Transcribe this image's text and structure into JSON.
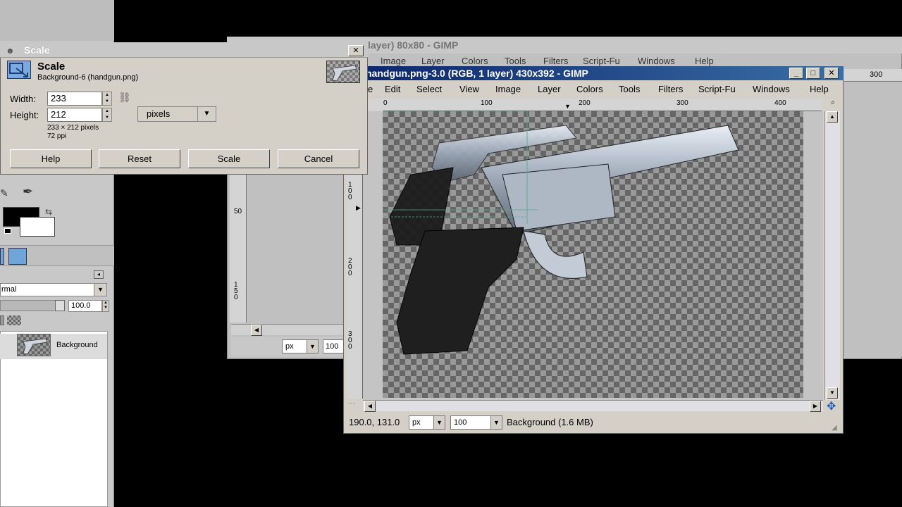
{
  "scale_dialog": {
    "title": "Scale",
    "heading": "Scale",
    "subheading": "Background-6 (handgun.png)",
    "width_label": "Width:",
    "width_value": "233",
    "height_label": "Height:",
    "height_value": "212",
    "units": "pixels",
    "dimensions_info": "233 × 212 pixels",
    "resolution_info": "72 ppi",
    "buttons": {
      "help": "Help",
      "reset": "Reset",
      "scale": "Scale",
      "cancel": "Cancel"
    },
    "close_glyph": "✕"
  },
  "background_window": {
    "title": "layer) 80x80 - GIMP",
    "menu": [
      "Image",
      "Layer",
      "Colors",
      "Tools",
      "Filters",
      "Script-Fu",
      "Windows",
      "Help"
    ],
    "ruler_top_label": "300",
    "ruler_left_labels": [
      "50",
      "150"
    ],
    "unit": "px",
    "zoom": "100"
  },
  "main_window": {
    "title": "handgun.png-3.0 (RGB, 1 layer) 430x392 - GIMP",
    "menu": [
      "e",
      "Edit",
      "Select",
      "View",
      "Image",
      "Layer",
      "Colors",
      "Tools",
      "Filters",
      "Script-Fu",
      "Windows",
      "Help"
    ],
    "ruler_top_labels": [
      "0",
      "100",
      "200",
      "300",
      "400"
    ],
    "ruler_left_labels": [
      "100",
      "200",
      "300"
    ],
    "coords": "190.0, 131.0",
    "unit": "px",
    "zoom": "100",
    "status": "Background (1.6 MB)",
    "window_buttons": {
      "minimize": "_",
      "maximize": "□",
      "close": "✕"
    }
  },
  "layers_panel": {
    "mode": "rmal",
    "opacity": "100.0",
    "layer_name": "Background"
  },
  "colors": {
    "title_active": "#0a246a",
    "title_active_end": "#3a6ea5",
    "dialog_bg": "#d4d0c8",
    "fg_color": "#000000",
    "bg_color": "#ffffff"
  }
}
